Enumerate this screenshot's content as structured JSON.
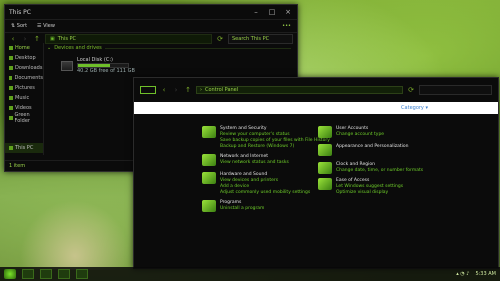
{
  "explorer": {
    "title": "This PC",
    "ribbon": {
      "sort": "Sort",
      "view": "View"
    },
    "address": "This PC",
    "search": "Search This PC",
    "sidebar": [
      {
        "label": "Home",
        "selected": true
      },
      {
        "label": "Desktop",
        "selected": false
      },
      {
        "label": "Downloads",
        "selected": false
      },
      {
        "label": "Documents",
        "selected": false
      },
      {
        "label": "Pictures",
        "selected": false
      },
      {
        "label": "Music",
        "selected": false
      },
      {
        "label": "Videos",
        "selected": false
      },
      {
        "label": "Green Folder",
        "selected": false
      }
    ],
    "nav_this_pc": "This PC",
    "group": "Devices and drives",
    "drive": {
      "name": "Local Disk (C:)",
      "free": "40.2 GB free of 111 GB",
      "fill": 0.64
    },
    "status": "1 item"
  },
  "control_panel": {
    "address": "Control Panel",
    "view_by": "Category",
    "categories": [
      {
        "title": "System and Security",
        "links": [
          "Review your computer's status",
          "Save backup copies of your files with File History",
          "Backup and Restore (Windows 7)"
        ]
      },
      {
        "title": "Network and Internet",
        "links": [
          "View network status and tasks"
        ]
      },
      {
        "title": "Hardware and Sound",
        "links": [
          "View devices and printers",
          "Add a device",
          "Adjust commonly used mobility settings"
        ]
      },
      {
        "title": "Programs",
        "links": [
          "Uninstall a program"
        ]
      },
      {
        "title": "User Accounts",
        "links": [
          "Change account type"
        ]
      },
      {
        "title": "Appearance and Personalization",
        "links": []
      },
      {
        "title": "Clock and Region",
        "links": [
          "Change date, time, or number formats"
        ]
      },
      {
        "title": "Ease of Access",
        "links": [
          "Let Windows suggest settings",
          "Optimize visual display"
        ]
      }
    ]
  },
  "taskbar": {
    "time": "5:33 AM"
  }
}
